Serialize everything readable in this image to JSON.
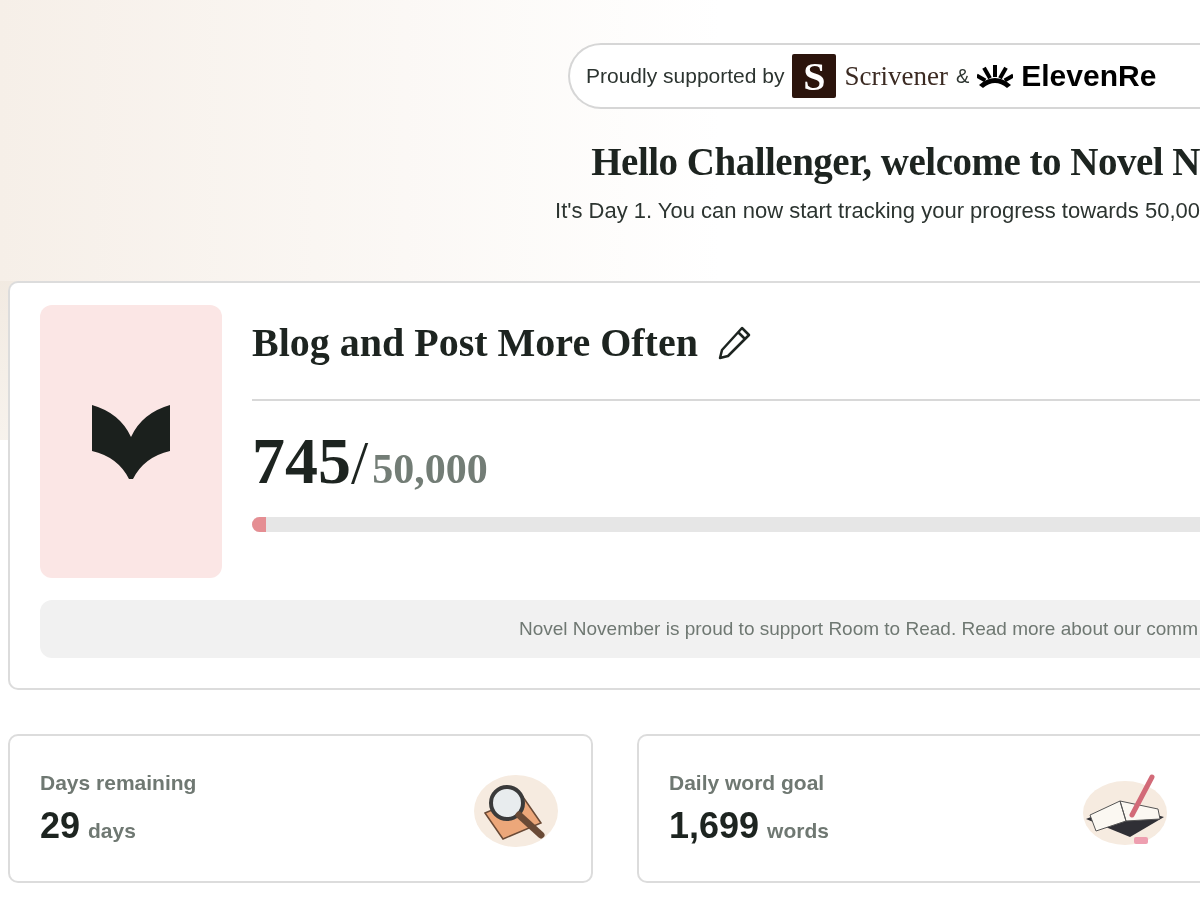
{
  "sponsor_banner": {
    "label": "Proudly supported by",
    "separator": "&",
    "sponsors": [
      {
        "kind": "square-mark",
        "mark": "S",
        "name": "Scrivener"
      },
      {
        "kind": "burst-mark",
        "name": "ElevenRe"
      }
    ]
  },
  "greeting": {
    "title": "Hello Challenger, welcome to Novel N",
    "subtitle": "It's Day 1. You can now start tracking your progress towards 50,00"
  },
  "project": {
    "title": "Blog and Post More Often",
    "word_count": "745",
    "separator": "/",
    "word_goal": "50,000",
    "progress": {
      "level": 0.015
    },
    "notice": "Novel November is proud to support Room to Read. Read more about our comm"
  },
  "stats": [
    {
      "kind": "days",
      "label": "Days remaining",
      "value": "29",
      "unit": "days"
    },
    {
      "kind": "words",
      "label": "Daily word goal",
      "value": "1,699",
      "unit": "words"
    }
  ]
}
